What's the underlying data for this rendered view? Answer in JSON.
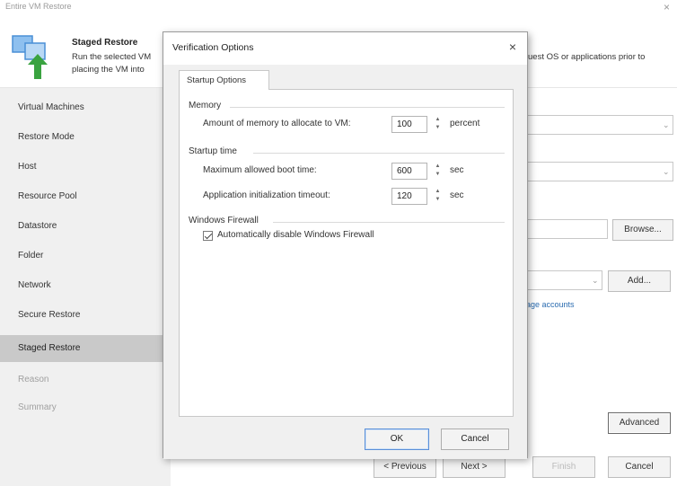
{
  "wizard": {
    "title": "Entire VM Restore",
    "close_label": "×",
    "header": {
      "title": "Staged Restore",
      "desc_line1": "Run the selected VM",
      "desc_line2": "placing the VM into",
      "desc_right": "uest OS or applications prior to"
    },
    "sidebar": {
      "items": [
        {
          "label": "Virtual Machines"
        },
        {
          "label": "Restore Mode"
        },
        {
          "label": "Host"
        },
        {
          "label": "Resource Pool"
        },
        {
          "label": "Datastore"
        },
        {
          "label": "Folder"
        },
        {
          "label": "Network"
        },
        {
          "label": "Secure Restore"
        },
        {
          "label": "Staged Restore"
        },
        {
          "label": "Reason"
        },
        {
          "label": "Summary"
        }
      ],
      "active_index": 8
    },
    "background": {
      "browse_label": "Browse...",
      "add_label": "Add...",
      "manage_accounts_link": "age accounts",
      "advanced_label": "Advanced"
    },
    "footer": {
      "previous_label": "< Previous",
      "next_label": "Next >",
      "finish_label": "Finish",
      "cancel_label": "Cancel"
    }
  },
  "dialog": {
    "title": "Verification Options",
    "close_label": "×",
    "tab_label": "Startup Options",
    "memory": {
      "group_label": "Memory",
      "row_label": "Amount of memory to allocate to VM:",
      "value": "100",
      "unit": "percent"
    },
    "startup_time": {
      "group_label": "Startup time",
      "boot_label": "Maximum allowed boot time:",
      "boot_value": "600",
      "boot_unit": "sec",
      "app_label": "Application initialization timeout:",
      "app_value": "120",
      "app_unit": "sec"
    },
    "firewall": {
      "group_label": "Windows Firewall",
      "checkbox_label": "Automatically disable Windows Firewall",
      "checked": true
    },
    "ok_label": "OK",
    "cancel_label": "Cancel"
  },
  "colors": {
    "active_sidebar": "#c9c9c9",
    "link": "#2b6cb0",
    "icon_arrow": "#3aa340",
    "icon_blue": "#4a8fd6"
  }
}
